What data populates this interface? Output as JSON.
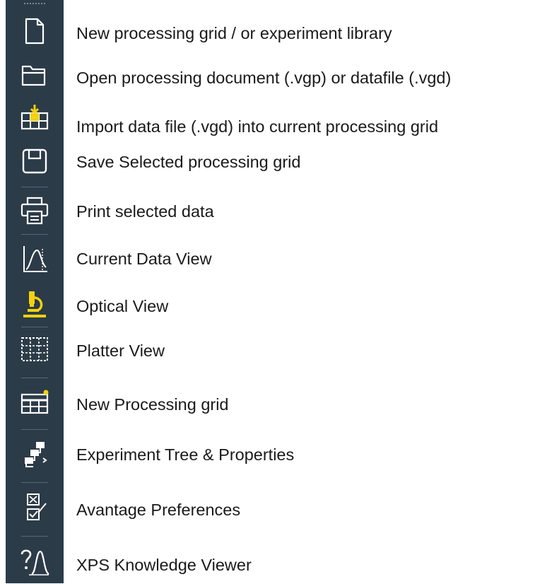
{
  "toolbar": {
    "accent_color": "#f5d20d",
    "background_color": "#2c3b48",
    "items": [
      {
        "icon": "new-document-icon",
        "label": "New processing grid / or experiment library"
      },
      {
        "icon": "open-folder-icon",
        "label": "Open processing document (.vgp) or datafile (.vgd)"
      },
      {
        "icon": "import-grid-icon",
        "label": "Import data file (.vgd) into current processing grid"
      },
      {
        "icon": "save-disk-icon",
        "label": "Save Selected processing grid"
      },
      {
        "icon": "printer-icon",
        "label": "Print selected data"
      },
      {
        "icon": "spectrum-curve-icon",
        "label": "Current Data View"
      },
      {
        "icon": "microscope-icon",
        "label": "Optical View"
      },
      {
        "icon": "platter-grid-icon",
        "label": "Platter View"
      },
      {
        "icon": "new-grid-icon",
        "label": "New Processing grid"
      },
      {
        "icon": "experiment-tree-icon",
        "label": "Experiment Tree & Properties"
      },
      {
        "icon": "preferences-checkbox-icon",
        "label": "Avantage Preferences"
      },
      {
        "icon": "help-knowledge-icon",
        "label": "XPS Knowledge Viewer"
      }
    ]
  }
}
